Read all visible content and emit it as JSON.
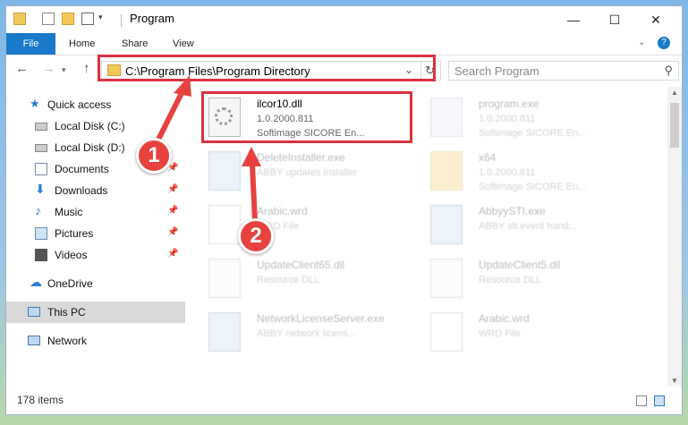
{
  "window": {
    "title": "Program",
    "controls": {
      "minimize": "—",
      "maximize": "☐",
      "close": "✕"
    }
  },
  "ribbon": {
    "tabs": [
      "File",
      "Home",
      "Share",
      "View"
    ]
  },
  "navigation": {
    "back": "←",
    "forward": "→",
    "up": "↑",
    "address": "C:\\Program Files\\Program Directory",
    "search_placeholder": "Search Program"
  },
  "sidebar": {
    "items": [
      {
        "label": "Quick access"
      },
      {
        "label": "Local Disk (C:)"
      },
      {
        "label": "Local Disk (D:)"
      },
      {
        "label": "Documents"
      },
      {
        "label": "Downloads"
      },
      {
        "label": "Music"
      },
      {
        "label": "Pictures"
      },
      {
        "label": "Videos"
      },
      {
        "label": "OneDrive"
      },
      {
        "label": "This PC"
      },
      {
        "label": "Network"
      }
    ]
  },
  "files": [
    {
      "name": "ilcor10.dll",
      "line2": "1.0.2000.811",
      "line3": "Softimage SICORE En..."
    },
    {
      "name": "program.exe",
      "line2": "1.0.2000.811",
      "line3": "Softimage SICORE En..."
    },
    {
      "name": "DeleteInstaller.exe",
      "line2": "ABBY updates installer",
      "line3": ""
    },
    {
      "name": "x64",
      "line2": "1.0.2000.811",
      "line3": "Softimage SICORE En..."
    },
    {
      "name": "Arabic.wrd",
      "line2": "WRD File",
      "line3": ""
    },
    {
      "name": "AbbyySTI.exe",
      "line2": "ABBY sti event hand...",
      "line3": ""
    },
    {
      "name": "UpdateClient65.dll",
      "line2": "Resource DLL",
      "line3": ""
    },
    {
      "name": "UpdateClient5.dll",
      "line2": "Resource DLL",
      "line3": ""
    },
    {
      "name": "NetworkLicenseServer.exe",
      "line2": "ABBY network licens...",
      "line3": ""
    },
    {
      "name": "Arabic.wrd",
      "line2": "WRD File",
      "line3": ""
    }
  ],
  "status": {
    "item_count": "178 items"
  },
  "annotations": {
    "callout1": "1",
    "callout2": "2"
  },
  "colors": {
    "accent": "#1979ca",
    "highlight": "#d9333f",
    "callout": "#e8423f"
  }
}
